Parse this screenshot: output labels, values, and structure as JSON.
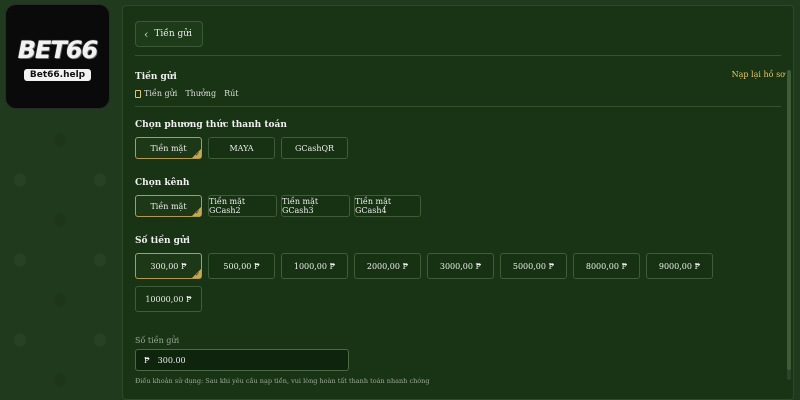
{
  "logo": {
    "brand": "BET66",
    "sub": "Bet66.help"
  },
  "header": {
    "back_label": "Tiền gửi"
  },
  "deposit": {
    "title": "Tiền gửi",
    "refill_link": "Nạp lại hồ sơ",
    "tabs": [
      {
        "label": "Tiền gửi",
        "icon": "wallet-icon",
        "active": true
      },
      {
        "label": "Thưởng",
        "active": false
      },
      {
        "label": "Rút",
        "active": false
      }
    ]
  },
  "payment_method": {
    "title": "Chọn phương thức thanh toán",
    "options": [
      {
        "label": "Tiền mặt",
        "selected": true
      },
      {
        "label": "MAYA",
        "selected": false
      },
      {
        "label": "GCashQR",
        "selected": false
      }
    ]
  },
  "channel": {
    "title": "Chọn kênh",
    "options": [
      {
        "label": "Tiền mặt",
        "selected": true
      },
      {
        "label": "Tiền mặt GCash2",
        "selected": false
      },
      {
        "label": "Tiền mặt GCash3",
        "selected": false
      },
      {
        "label": "Tiền mặt GCash4",
        "selected": false
      }
    ]
  },
  "amounts": {
    "title": "Số tiền gửi",
    "options": [
      {
        "label": "300,00 ₱",
        "selected": true
      },
      {
        "label": "500,00 ₱",
        "selected": false
      },
      {
        "label": "1000,00 ₱",
        "selected": false
      },
      {
        "label": "2000,00 ₱",
        "selected": false
      },
      {
        "label": "3000,00 ₱",
        "selected": false
      },
      {
        "label": "5000,00 ₱",
        "selected": false
      },
      {
        "label": "8000,00 ₱",
        "selected": false
      },
      {
        "label": "9000,00 ₱",
        "selected": false
      },
      {
        "label": "10000,00 ₱",
        "selected": false
      }
    ]
  },
  "amount_field": {
    "label": "Số tiền gửi",
    "currency": "₱",
    "value": "300.00"
  },
  "terms": "Điều khoản sử dụng: Sau khi yêu cầu nạp tiền, vui lòng hoàn tất thanh toán nhanh chóng",
  "colors": {
    "accent": "#c8a74e",
    "panel": "#183414",
    "background": "#1f3a1c"
  }
}
